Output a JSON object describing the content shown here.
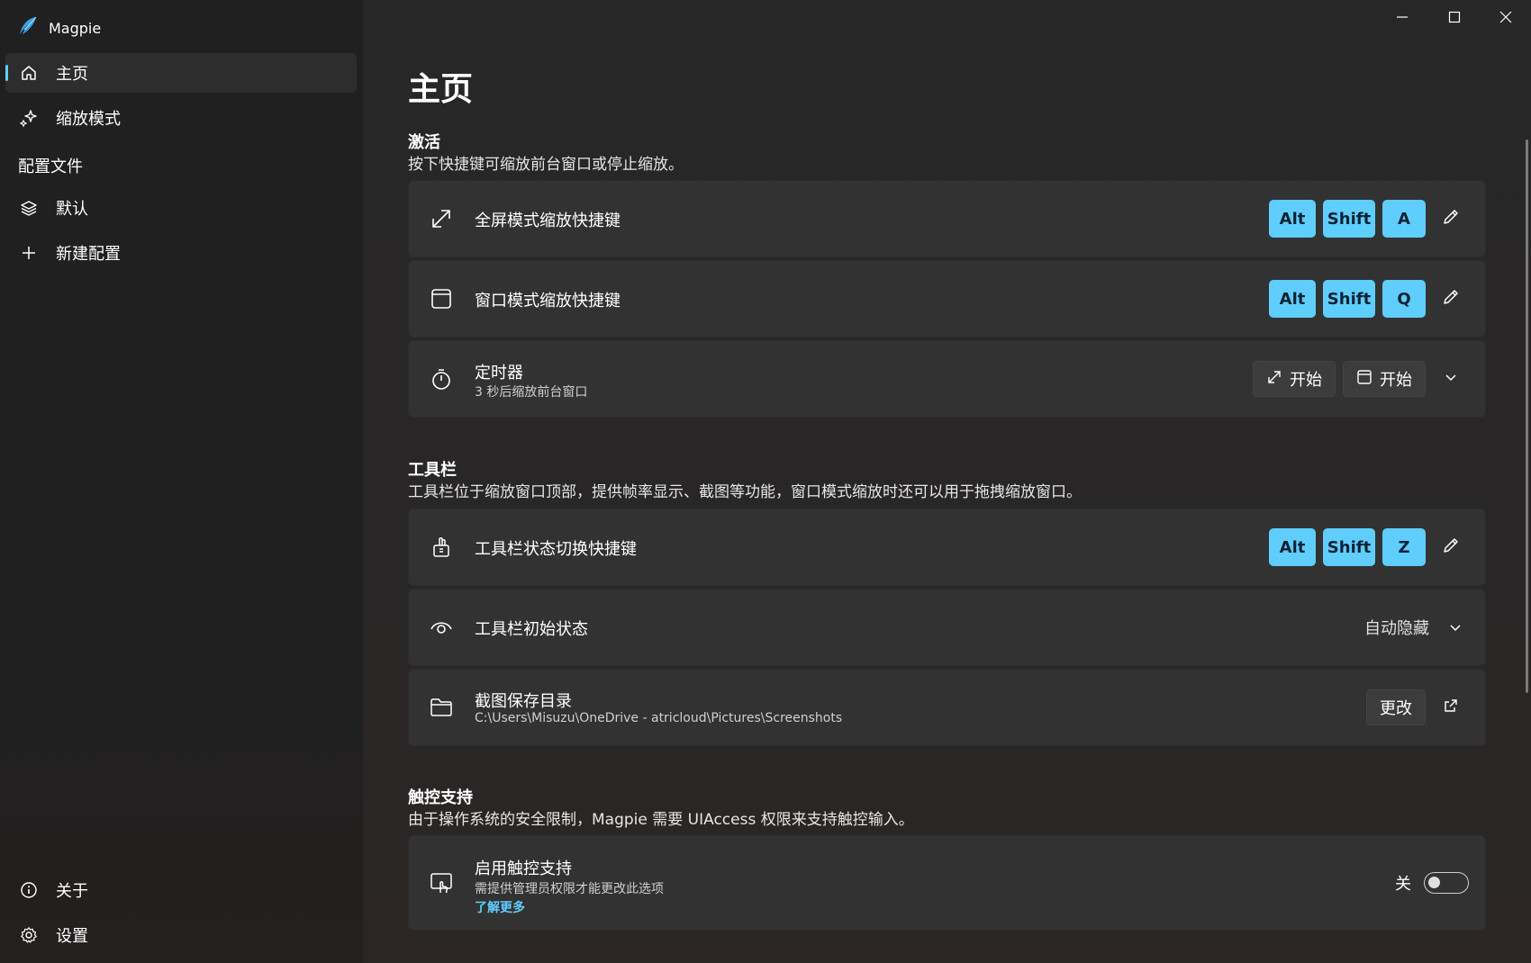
{
  "app": {
    "title": "Magpie"
  },
  "colors": {
    "accent": "#60cdff",
    "card_bg": "#323232",
    "sidebar_bg": "#202020",
    "main_bg": "#272727"
  },
  "sidebar": {
    "items": [
      {
        "label": "主页",
        "icon": "home-icon",
        "selected": true
      },
      {
        "label": "缩放模式",
        "icon": "sparkle-icon"
      }
    ],
    "profiles_header": "配置文件",
    "profiles": [
      {
        "label": "默认",
        "icon": "layers-icon"
      },
      {
        "label": "新建配置",
        "icon": "plus-icon"
      }
    ],
    "footer": [
      {
        "label": "关于",
        "icon": "info-icon"
      },
      {
        "label": "设置",
        "icon": "gear-icon"
      }
    ]
  },
  "page": {
    "title": "主页",
    "sections": {
      "activation": {
        "title": "激活",
        "desc": "按下快捷键可缩放前台窗口或停止缩放。",
        "fullscreen": {
          "title": "全屏模式缩放快捷键",
          "keys": [
            "Alt",
            "Shift",
            "A"
          ]
        },
        "windowed": {
          "title": "窗口模式缩放快捷键",
          "keys": [
            "Alt",
            "Shift",
            "Q"
          ]
        },
        "timer": {
          "title": "定时器",
          "sub": "3 秒后缩放前台窗口",
          "btn_fullscreen": "开始",
          "btn_windowed": "开始"
        }
      },
      "toolbar": {
        "title": "工具栏",
        "desc": "工具栏位于缩放窗口顶部，提供帧率显示、截图等功能，窗口模式缩放时还可以用于拖拽缩放窗口。",
        "toggle_hotkey": {
          "title": "工具栏状态切换快捷键",
          "keys": [
            "Alt",
            "Shift",
            "Z"
          ]
        },
        "initial_state": {
          "title": "工具栏初始状态",
          "value": "自动隐藏"
        },
        "screenshot_dir": {
          "title": "截图保存目录",
          "path": "C:\\Users\\Misuzu\\OneDrive - atricloud\\Pictures\\Screenshots",
          "change_label": "更改"
        }
      },
      "touch": {
        "title": "触控支持",
        "desc": "由于操作系统的安全限制，Magpie 需要 UIAccess 权限来支持触控输入。",
        "enable": {
          "title": "启用触控支持",
          "sub": "需提供管理员权限才能更改此选项",
          "link": "了解更多",
          "state_label": "关"
        }
      }
    }
  }
}
